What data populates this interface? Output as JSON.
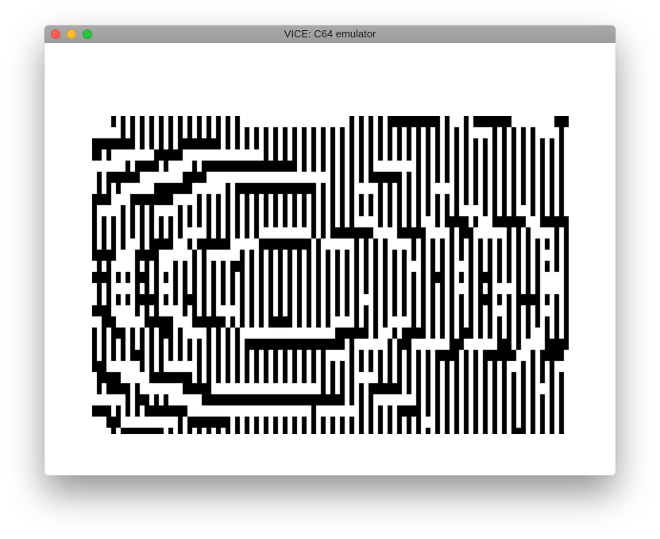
{
  "window": {
    "title": "VICE: C64 emulator"
  },
  "titlebar": {
    "buttons": [
      {
        "name": "close-button",
        "icon": "close-icon",
        "color": "#fc5f57"
      },
      {
        "name": "minimize-button",
        "icon": "minimize-icon",
        "color": "#fdbc2e"
      },
      {
        "name": "zoom-button",
        "icon": "zoom-icon",
        "color": "#28c840"
      }
    ]
  },
  "display": {
    "content": "black-and-white moire block pattern",
    "foreground": "#000000",
    "background": "#ffffff"
  }
}
